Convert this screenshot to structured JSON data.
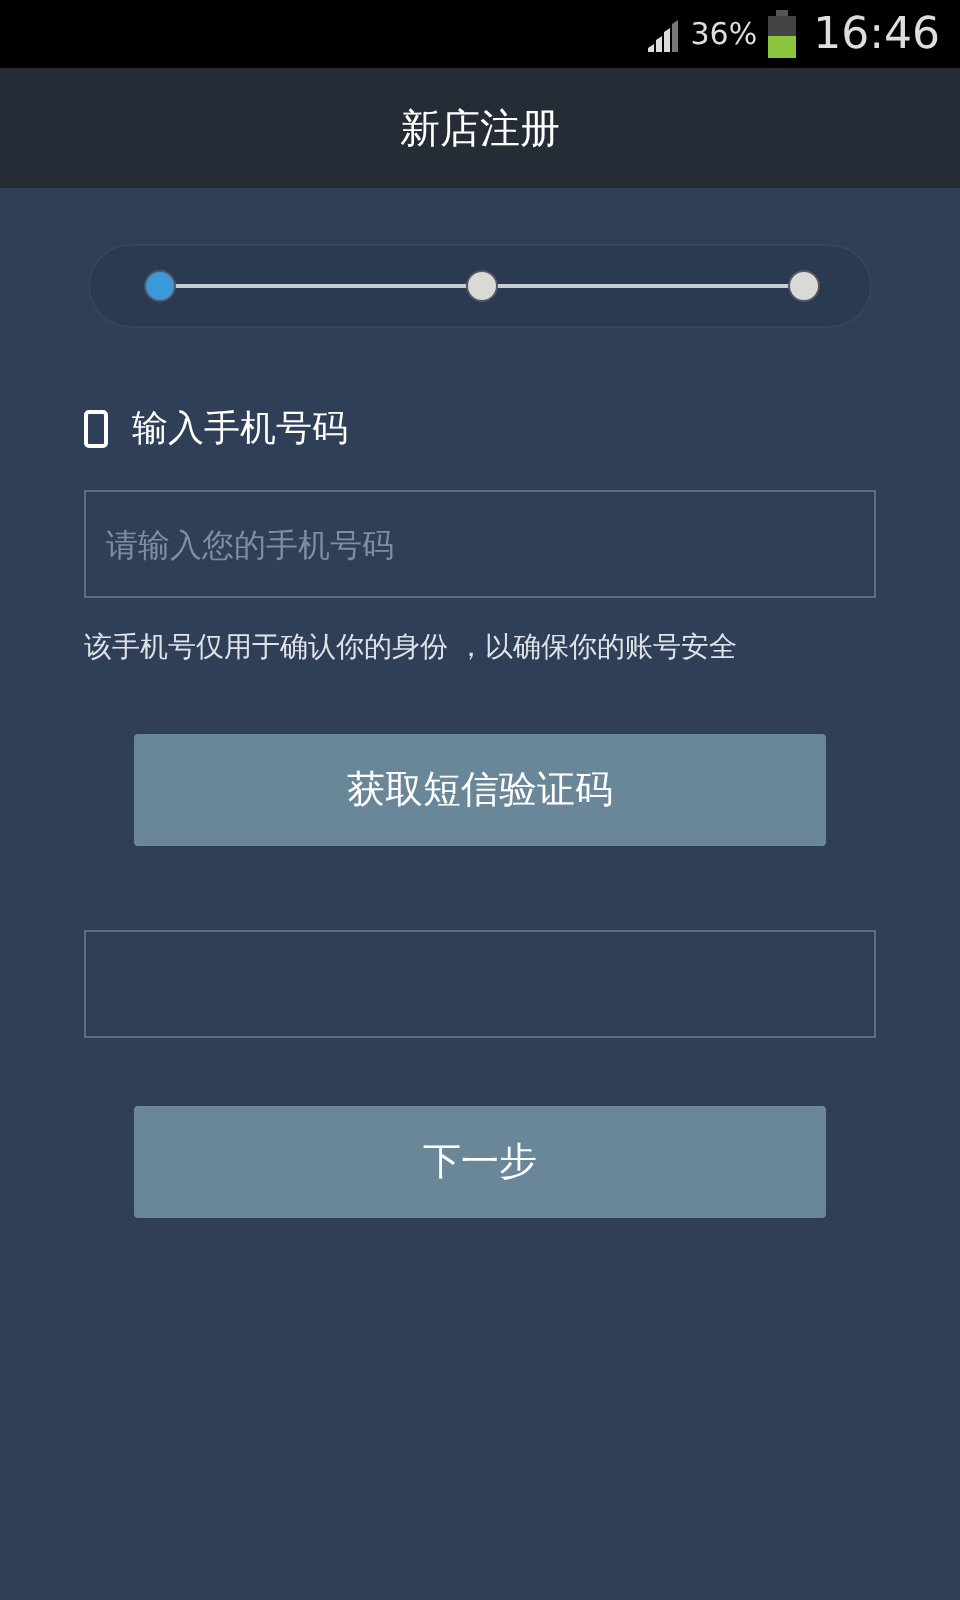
{
  "status_bar": {
    "battery_percent": "36%",
    "time": "16:46"
  },
  "title_bar": {
    "title": "新店注册"
  },
  "steps": [
    {
      "selected": true
    },
    {
      "selected": false
    },
    {
      "selected": false
    }
  ],
  "phone_section": {
    "label": "输入手机号码",
    "placeholder": "请输入您的手机号码",
    "hint": "该手机号仅用于确认你的身份 ，以确保你的账号安全"
  },
  "sms_button": {
    "label": "获取短信验证码"
  },
  "next_button": {
    "label": "下一步"
  }
}
